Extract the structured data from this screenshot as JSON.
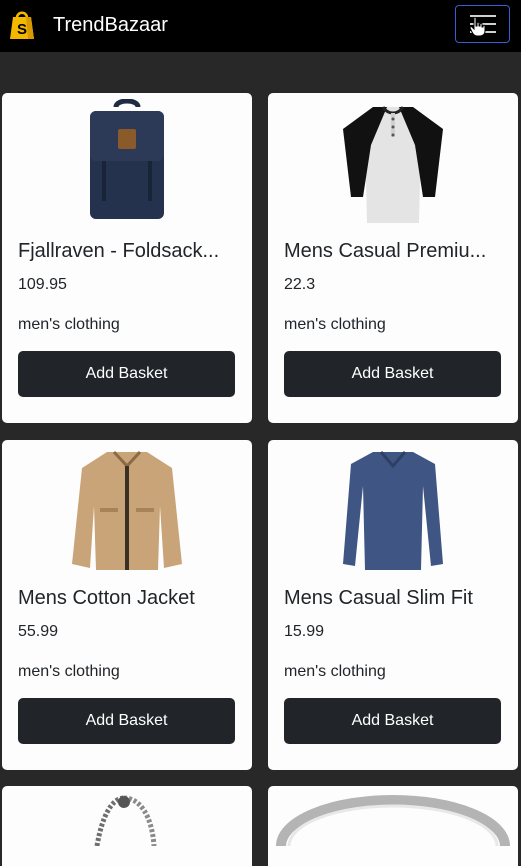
{
  "navbar": {
    "brand_name": "TrendBazaar",
    "logo_icon": "shopping-bag-icon",
    "menu_icon": "hamburger-menu-icon",
    "accent_color": "#3b5bd6"
  },
  "products": [
    {
      "title": "Fjallraven - Foldsack...",
      "price": "109.95",
      "category": "men's clothing",
      "button_label": "Add Basket",
      "image": "backpack-image"
    },
    {
      "title": "Mens Casual Premiu...",
      "price": "22.3",
      "category": "men's clothing",
      "button_label": "Add Basket",
      "image": "raglan-tshirt-image"
    },
    {
      "title": "Mens Cotton Jacket",
      "price": "55.99",
      "category": "men's clothing",
      "button_label": "Add Basket",
      "image": "cotton-jacket-image"
    },
    {
      "title": "Mens Casual Slim Fit",
      "price": "15.99",
      "category": "men's clothing",
      "button_label": "Add Basket",
      "image": "slim-fit-shirt-image"
    },
    {
      "image": "chain-bracelet-image"
    },
    {
      "image": "silver-ring-image"
    }
  ]
}
